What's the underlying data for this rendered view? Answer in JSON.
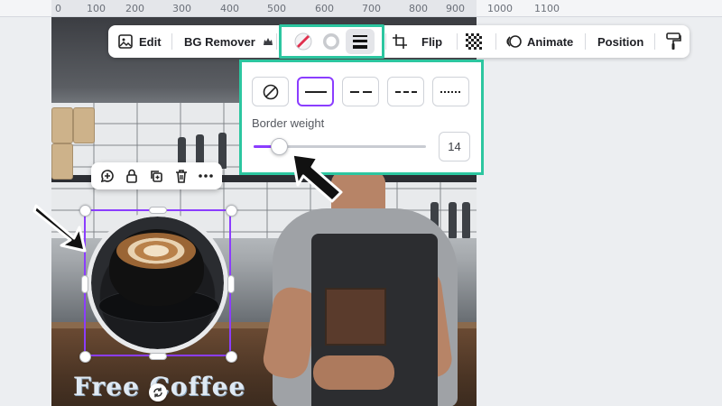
{
  "ruler": {
    "ticks": [
      "0",
      "100",
      "200",
      "300",
      "400",
      "500",
      "600",
      "700",
      "800",
      "900",
      "1000",
      "1100"
    ]
  },
  "toolbar": {
    "edit_label": "Edit",
    "bg_remover_label": "BG Remover",
    "flip_label": "Flip",
    "animate_label": "Animate",
    "position_label": "Position"
  },
  "border_popup": {
    "styles": [
      "none",
      "solid",
      "dashed-long",
      "dashed-short",
      "dotted"
    ],
    "selected_style": "solid",
    "weight_label": "Border weight",
    "weight_value": "14",
    "weight_min": 0,
    "weight_max": 100
  },
  "canvas": {
    "headline": "Free Coffee"
  },
  "colors": {
    "accent": "#8b3dff",
    "highlight": "#2cc6a0"
  },
  "icons": {
    "mini_bar": [
      "comment-add-icon",
      "lock-icon",
      "duplicate-icon",
      "trash-icon",
      "more-icon"
    ],
    "toolbar": [
      "edit-image-icon",
      "crown-icon",
      "border-color-icon",
      "border-style-icon",
      "border-weight-icon",
      "crop-icon",
      "transparency-icon",
      "animate-icon",
      "copy-style-icon"
    ]
  }
}
